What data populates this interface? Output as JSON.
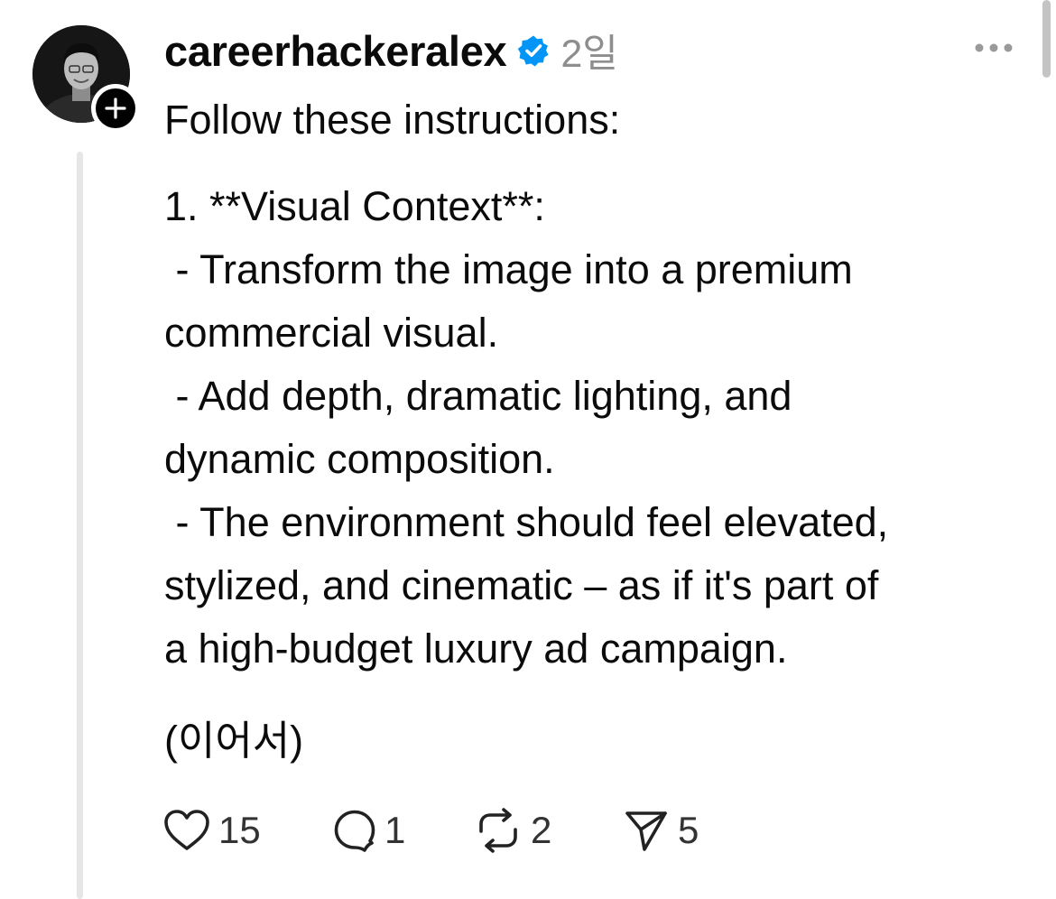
{
  "post": {
    "username": "careerhackeralex",
    "verified": true,
    "time": "2일",
    "text": {
      "intro": "Follow these instructions:",
      "lines": [
        "1. **Visual Context**:",
        " - Transform the image into a premium",
        "commercial visual.",
        " - Add depth, dramatic lighting, and",
        "dynamic composition.",
        " - The environment should feel elevated,",
        "stylized, and cinematic – as if it's part of",
        "a high-budget luxury ad campaign."
      ],
      "continued": "(이어서)"
    },
    "stats": {
      "likes": "15",
      "replies": "1",
      "reposts": "2",
      "shares": "5"
    }
  },
  "icons": {
    "verified": "verified-badge-icon",
    "more": "more-horizontal-icon",
    "like": "heart-icon",
    "reply": "speech-bubble-icon",
    "repost": "repost-icon",
    "share": "paper-plane-icon",
    "follow": "plus-icon"
  },
  "colors": {
    "verified_blue": "#0095f6",
    "text": "#0b0b0b",
    "muted": "#8e8e8e",
    "thread_line": "#e6e6e6"
  }
}
